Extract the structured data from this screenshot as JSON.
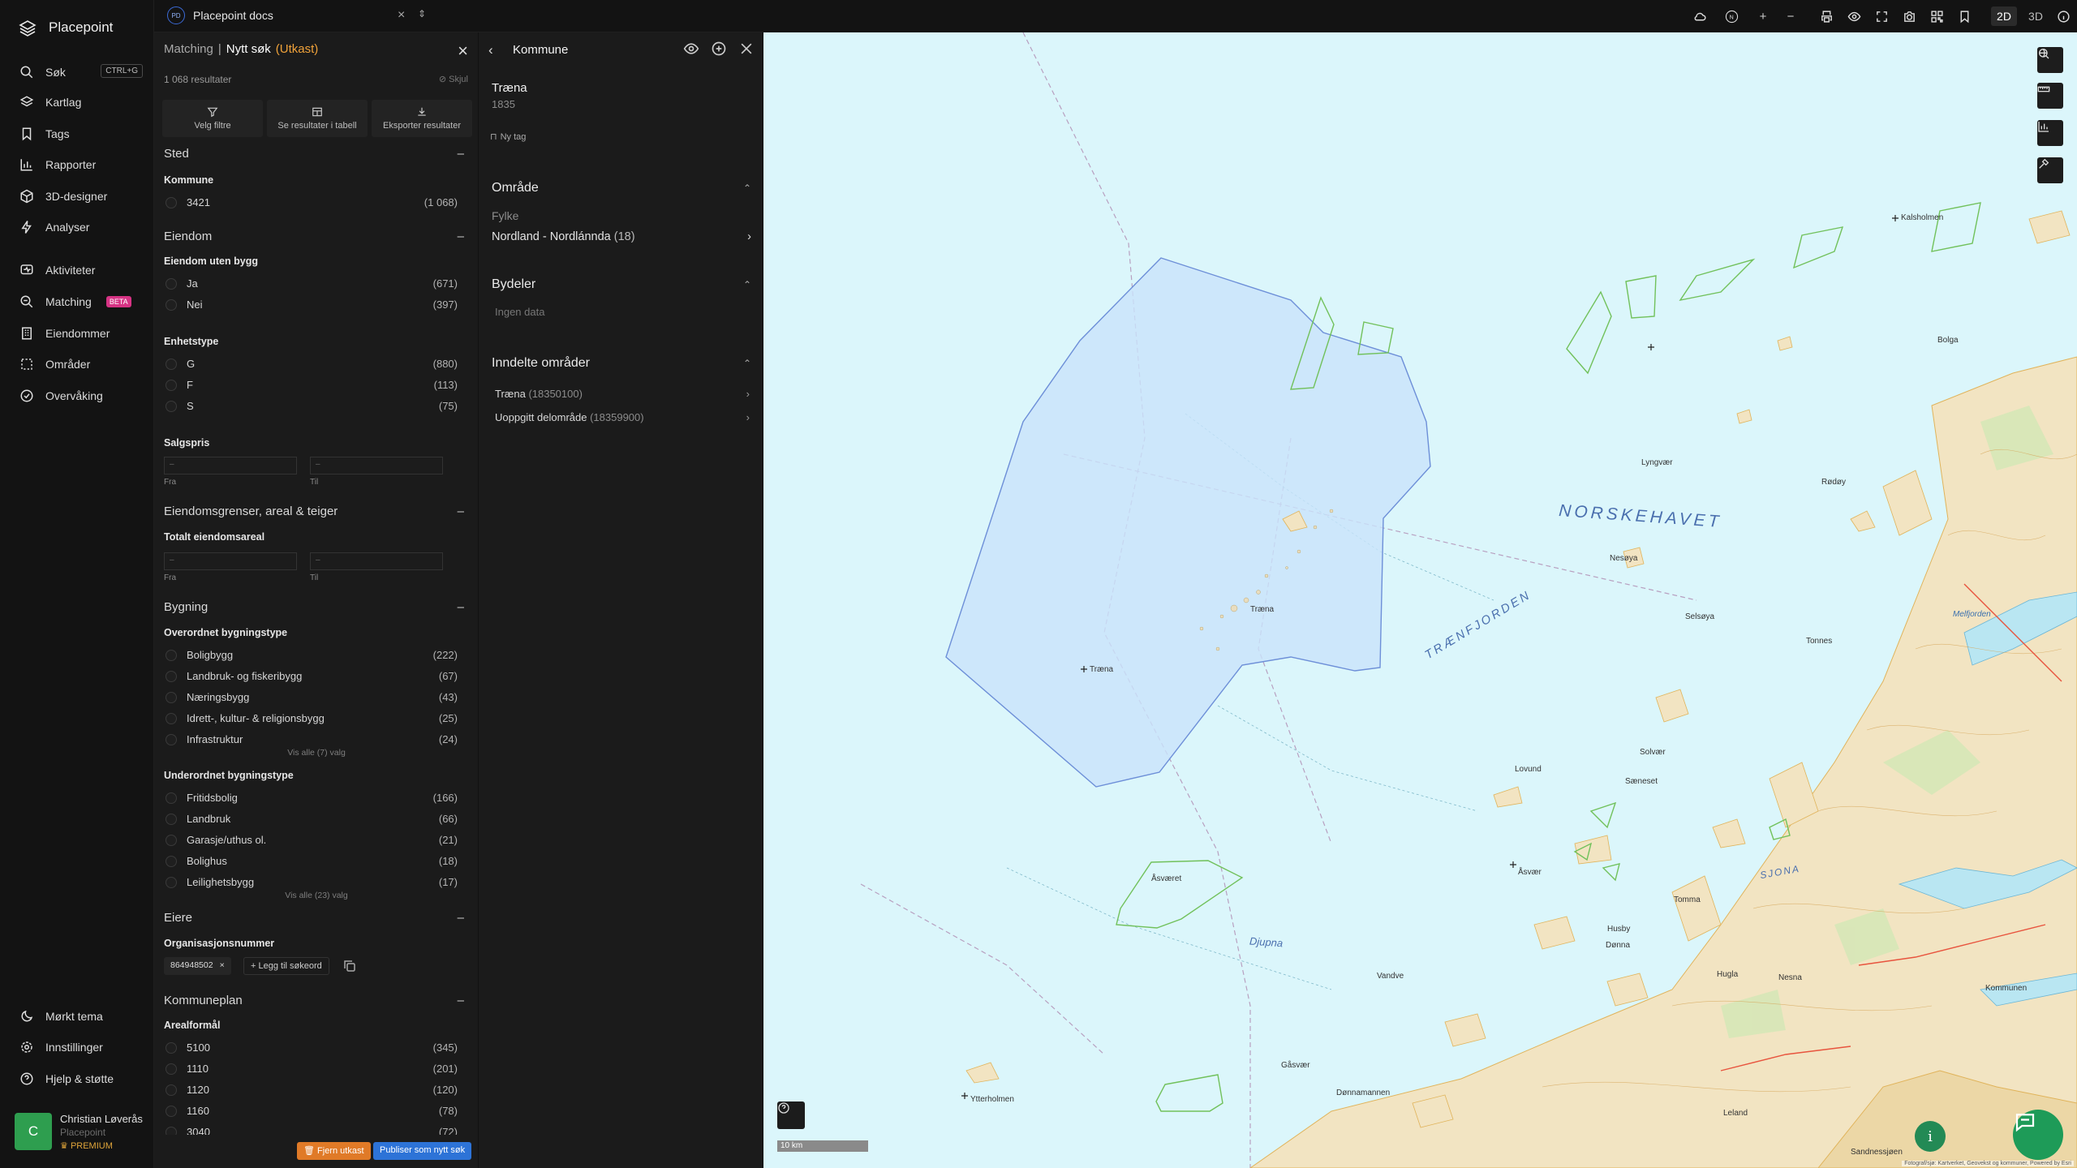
{
  "nav": {
    "brand": "Placepoint",
    "items": [
      {
        "label": "Søk",
        "kbd": "CTRL+G"
      },
      {
        "label": "Kartlag"
      },
      {
        "label": "Tags"
      },
      {
        "label": "Rapporter"
      },
      {
        "label": "3D-designer"
      },
      {
        "label": "Analyser"
      },
      {
        "label": "Aktiviteter"
      },
      {
        "label": "Matching",
        "badge": "BETA"
      },
      {
        "label": "Eiendommer"
      },
      {
        "label": "Områder"
      },
      {
        "label": "Overvåking"
      }
    ],
    "bottom": [
      {
        "label": "Mørkt tema"
      },
      {
        "label": "Innstillinger"
      },
      {
        "label": "Hjelp & støtte"
      }
    ],
    "user": {
      "initial": "C",
      "name": "Christian Løverås",
      "org": "Placepoint",
      "plan": "PREMIUM"
    }
  },
  "topbar": {
    "workspace_badge": "PD",
    "workspace": "Placepoint docs",
    "mode_2d": "2D",
    "mode_3d": "3D"
  },
  "search": {
    "crumb_matching": "Matching",
    "sep": "|",
    "title": "Nytt søk",
    "draft": "(Utkast)",
    "results": "1 068 resultater",
    "hide": "Skjul",
    "actions": [
      "Velg filtre",
      "Se resultater i tabell",
      "Eksporter resultater"
    ],
    "sections": {
      "sted": "Sted",
      "kommune": "Kommune",
      "eiendom": "Eiendom",
      "eiendom_uten_bygg": "Eiendom uten bygg",
      "enhetstype": "Enhetstype",
      "salgspris": "Salgspris",
      "grenser": "Eiendomsgrenser, areal & teiger",
      "totalt": "Totalt eiendomsareal",
      "bygning": "Bygning",
      "overordnet": "Overordnet bygningstype",
      "underordnet": "Underordnet bygningstype",
      "eiere": "Eiere",
      "orgnr": "Organisasjonsnummer",
      "kommuneplan": "Kommuneplan",
      "arealformal": "Arealformål"
    },
    "kommune_opts": [
      {
        "label": "3421",
        "count": "(1 068)"
      }
    ],
    "uten_bygg_opts": [
      {
        "label": "Ja",
        "count": "(671)"
      },
      {
        "label": "Nei",
        "count": "(397)"
      }
    ],
    "enhet_opts": [
      {
        "label": "G",
        "count": "(880)"
      },
      {
        "label": "F",
        "count": "(113)"
      },
      {
        "label": "S",
        "count": "(75)"
      }
    ],
    "range": {
      "placeholder": "–",
      "from": "Fra",
      "to": "Til"
    },
    "overordnet_opts": [
      {
        "label": "Boligbygg",
        "count": "(222)"
      },
      {
        "label": "Landbruk- og fiskeribygg",
        "count": "(67)"
      },
      {
        "label": "Næringsbygg",
        "count": "(43)"
      },
      {
        "label": "Idrett-, kultur- & religionsbygg",
        "count": "(25)"
      },
      {
        "label": "Infrastruktur",
        "count": "(24)"
      }
    ],
    "overordnet_all": "Vis alle (7) valg",
    "underordnet_opts": [
      {
        "label": "Fritidsbolig",
        "count": "(166)"
      },
      {
        "label": "Landbruk",
        "count": "(66)"
      },
      {
        "label": "Garasje/uthus ol.",
        "count": "(21)"
      },
      {
        "label": "Bolighus",
        "count": "(18)"
      },
      {
        "label": "Leilighetsbygg",
        "count": "(17)"
      }
    ],
    "underordnet_all": "Vis alle (23) valg",
    "orgnr_chip": "864948502",
    "add_keyword": "Legg til søkeord",
    "arealformal_opts": [
      {
        "label": "5100",
        "count": "(345)"
      },
      {
        "label": "1110",
        "count": "(201)"
      },
      {
        "label": "1120",
        "count": "(120)"
      },
      {
        "label": "1160",
        "count": "(78)"
      },
      {
        "label": "3040",
        "count": "(72)"
      }
    ],
    "btn_delete": "Fjern utkast",
    "btn_publish": "Publiser som nytt søk"
  },
  "kommune": {
    "title": "Kommune",
    "name": "Træna",
    "code": "1835",
    "new_tag": "Ny tag",
    "omrade": "Område",
    "fylke_label": "Fylke",
    "fylke": "Nordland - Nordlánnda",
    "fylke_count": "(18)",
    "bydeler": "Bydeler",
    "no_data": "Ingen data",
    "inndelte": "Inndelte områder",
    "areas": [
      {
        "name": "Træna",
        "code": "(18350100)"
      },
      {
        "name": "Uoppgitt delområde",
        "code": "(18359900)"
      }
    ]
  },
  "map": {
    "sea_label": "NORSKEHAVET",
    "fjord_label": "TRÆNFJORDEN",
    "djupna": "Djupna",
    "sjona": "SJONA",
    "places": [
      "Træna",
      "Træna",
      "Kalsholmen",
      "Bolga",
      "Lyngvær",
      "Nesøya",
      "Selsøya",
      "Solvær",
      "Sæneset",
      "Lovund",
      "Åsværet",
      "Åsvær",
      "Ytterholmen",
      "Gåsvær",
      "Dønnamannen",
      "Dønna",
      "Vandve",
      "Husby",
      "Tomma",
      "Hugla",
      "Nesna",
      "Melfjorden",
      "Rødøy",
      "Tonnes",
      "Sandnessjøen",
      "Leland",
      "Kommunen"
    ],
    "scale": "10 km",
    "attribution": "Fotograf/sjø: Kartverket, Geovekst og kommuner, Powered by Esri"
  },
  "colors": {
    "accent": "#2d73d7",
    "draft": "#f0a23a",
    "beta": "#d63384",
    "user": "#2e9e4f",
    "sea": "#dbf6fb",
    "polygon": "#c9e4fb"
  }
}
